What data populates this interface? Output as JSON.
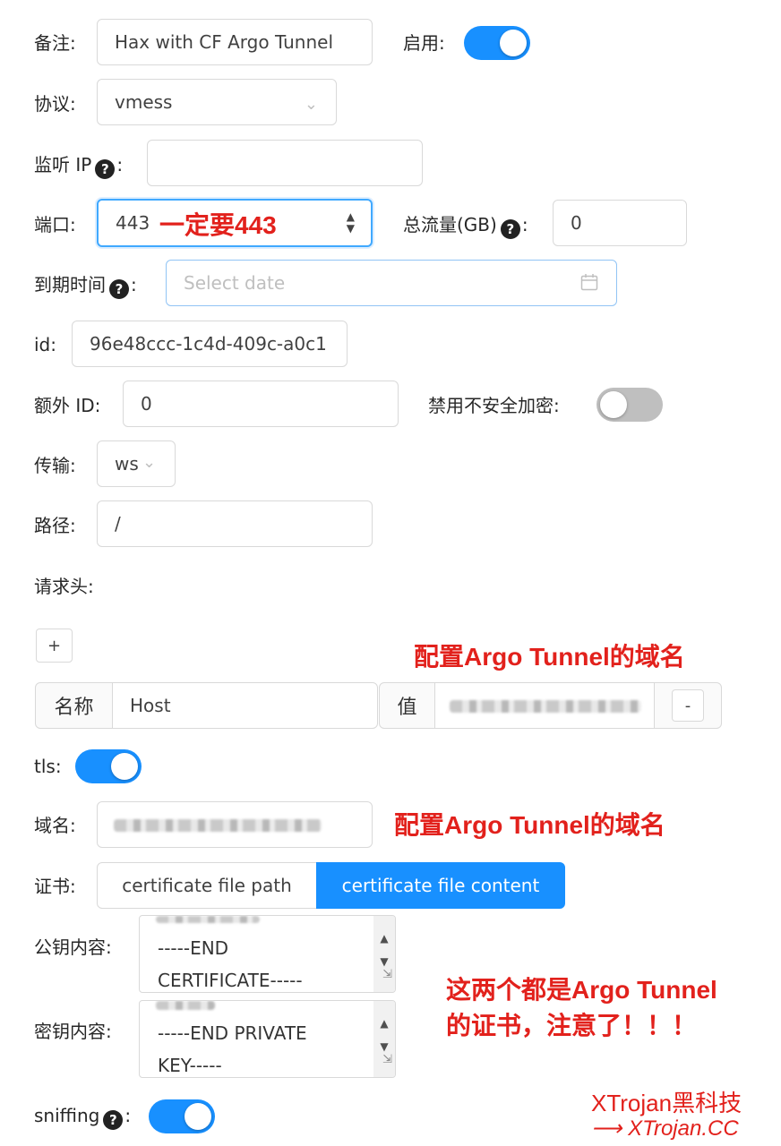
{
  "remark": {
    "label": "备注:",
    "value": "Hax with CF Argo Tunnel"
  },
  "enable": {
    "label": "启用:",
    "on": true
  },
  "protocol": {
    "label": "协议:",
    "value": "vmess"
  },
  "listen_ip": {
    "label": "监听 IP",
    "colon": ":",
    "value": ""
  },
  "port": {
    "label": "端口:",
    "value": "443",
    "note": "一定要443"
  },
  "total_traffic": {
    "label": "总流量(GB)",
    "colon": ":",
    "value": "0"
  },
  "expiry": {
    "label": "到期时间",
    "colon": ":",
    "placeholder": "Select date"
  },
  "id_field": {
    "label": "id:",
    "value": "96e48ccc-1c4d-409c-a0c1"
  },
  "alter_id": {
    "label": "额外 ID:",
    "value": "0"
  },
  "disable_insecure": {
    "label": "禁用不安全加密:",
    "on": false
  },
  "transport": {
    "label": "传输:",
    "value": "ws"
  },
  "path": {
    "label": "路径:",
    "value": "/"
  },
  "headers": {
    "label": "请求头:",
    "add_label": "+",
    "name_label": "名称",
    "name_value": "Host",
    "value_label": "值",
    "remove_label": "-",
    "note": "配置Argo Tunnel的域名"
  },
  "tls": {
    "label": "tls:",
    "on": true
  },
  "domain": {
    "label": "域名:",
    "note": "配置Argo Tunnel的域名"
  },
  "cert": {
    "label": "证书:",
    "tab_path": "certificate file path",
    "tab_content": "certificate file content",
    "active": "content"
  },
  "public_key": {
    "label": "公钥内容:",
    "line1": "-----END",
    "line2": "CERTIFICATE-----"
  },
  "private_key": {
    "label": "密钥内容:",
    "line1": "-----END PRIVATE",
    "line2": "KEY-----"
  },
  "cert_note": {
    "line1": "这两个都是Argo Tunnel",
    "line2": "的证书，注意了！！！"
  },
  "sniffing": {
    "label": "sniffing",
    "colon": ":",
    "on": true
  },
  "watermark": {
    "line1": "XTrojan黑科技",
    "line2": "XTrojan.CC",
    "arrow": "⟶"
  },
  "colors": {
    "primary": "#1890ff",
    "note_red": "#e2211c",
    "watermark_red": "#e2211c"
  }
}
